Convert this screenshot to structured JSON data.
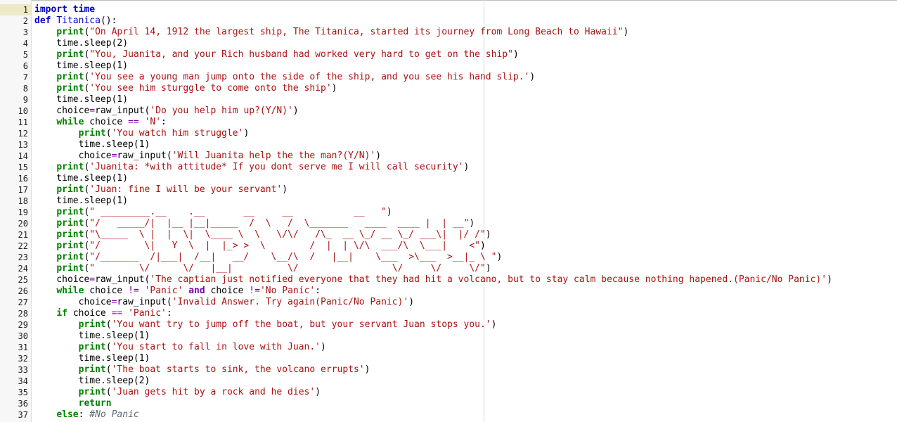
{
  "editor": {
    "colors": {
      "keyword": "#0000cc",
      "builtin": "#008000",
      "string": "#aa1111",
      "comment": "#5a6a7a",
      "operator": "#7700aa",
      "gutter_bg": "#f7f7f7",
      "active_line_number_bg": "#ece9c6"
    },
    "active_line": 1,
    "lines": [
      {
        "n": "1",
        "t": [
          {
            "c": "kw",
            "s": "import"
          },
          {
            "c": "var",
            "s": " "
          },
          {
            "c": "kw",
            "s": "time"
          }
        ]
      },
      {
        "n": "2",
        "t": [
          {
            "c": "kw",
            "s": "def"
          },
          {
            "c": "var",
            "s": " "
          },
          {
            "c": "def",
            "s": "Titanica"
          },
          {
            "c": "var",
            "s": "():"
          }
        ]
      },
      {
        "n": "3",
        "t": [
          {
            "c": "var",
            "s": "    "
          },
          {
            "c": "kw2",
            "s": "print"
          },
          {
            "c": "var",
            "s": "("
          },
          {
            "c": "str",
            "s": "\"On April 14, 1912 the largest ship, The Titanica, started its journey from Long Beach to Hawaii\""
          },
          {
            "c": "var",
            "s": ")"
          }
        ]
      },
      {
        "n": "4",
        "t": [
          {
            "c": "var",
            "s": "    time.sleep("
          },
          {
            "c": "var",
            "s": "2"
          },
          {
            "c": "var",
            "s": ")"
          }
        ]
      },
      {
        "n": "5",
        "t": [
          {
            "c": "var",
            "s": "    "
          },
          {
            "c": "kw2",
            "s": "print"
          },
          {
            "c": "var",
            "s": "("
          },
          {
            "c": "str",
            "s": "\"You, Juanita, and your Rich husband had worked very hard to get on the ship\""
          },
          {
            "c": "var",
            "s": ")"
          }
        ]
      },
      {
        "n": "6",
        "t": [
          {
            "c": "var",
            "s": "    time.sleep("
          },
          {
            "c": "var",
            "s": "1"
          },
          {
            "c": "var",
            "s": ")"
          }
        ]
      },
      {
        "n": "7",
        "t": [
          {
            "c": "var",
            "s": "    "
          },
          {
            "c": "kw2",
            "s": "print"
          },
          {
            "c": "var",
            "s": "("
          },
          {
            "c": "str",
            "s": "'You see a young man jump onto the side of the ship, and you see his hand slip.'"
          },
          {
            "c": "var",
            "s": ")"
          }
        ]
      },
      {
        "n": "8",
        "t": [
          {
            "c": "var",
            "s": "    "
          },
          {
            "c": "kw2",
            "s": "print"
          },
          {
            "c": "var",
            "s": "("
          },
          {
            "c": "str",
            "s": "'You see him sturggle to come onto the ship'"
          },
          {
            "c": "var",
            "s": ")"
          }
        ]
      },
      {
        "n": "9",
        "t": [
          {
            "c": "var",
            "s": "    time.sleep("
          },
          {
            "c": "var",
            "s": "1"
          },
          {
            "c": "var",
            "s": ")"
          }
        ]
      },
      {
        "n": "10",
        "t": [
          {
            "c": "var",
            "s": "    choice"
          },
          {
            "c": "op",
            "s": "="
          },
          {
            "c": "var",
            "s": "raw_input("
          },
          {
            "c": "str",
            "s": "'Do you help him up?(Y/N)'"
          },
          {
            "c": "var",
            "s": ")"
          }
        ]
      },
      {
        "n": "11",
        "t": [
          {
            "c": "var",
            "s": "    "
          },
          {
            "c": "kw2",
            "s": "while"
          },
          {
            "c": "var",
            "s": " choice "
          },
          {
            "c": "op",
            "s": "=="
          },
          {
            "c": "var",
            "s": " "
          },
          {
            "c": "str",
            "s": "'N'"
          },
          {
            "c": "var",
            "s": ":"
          }
        ]
      },
      {
        "n": "12",
        "t": [
          {
            "c": "var",
            "s": "        "
          },
          {
            "c": "kw2",
            "s": "print"
          },
          {
            "c": "var",
            "s": "("
          },
          {
            "c": "str",
            "s": "'You watch him struggle'"
          },
          {
            "c": "var",
            "s": ")"
          }
        ]
      },
      {
        "n": "13",
        "t": [
          {
            "c": "var",
            "s": "        time.sleep("
          },
          {
            "c": "var",
            "s": "1"
          },
          {
            "c": "var",
            "s": ")"
          }
        ]
      },
      {
        "n": "14",
        "t": [
          {
            "c": "var",
            "s": "        choice"
          },
          {
            "c": "op",
            "s": "="
          },
          {
            "c": "var",
            "s": "raw_input("
          },
          {
            "c": "str",
            "s": "'Will Juanita help the the man?(Y/N)'"
          },
          {
            "c": "var",
            "s": ")"
          }
        ]
      },
      {
        "n": "15",
        "t": [
          {
            "c": "var",
            "s": "    "
          },
          {
            "c": "kw2",
            "s": "print"
          },
          {
            "c": "var",
            "s": "("
          },
          {
            "c": "str",
            "s": "'Juanita: *with attitude* If you dont serve me I will call security'"
          },
          {
            "c": "var",
            "s": ")"
          }
        ]
      },
      {
        "n": "16",
        "t": [
          {
            "c": "var",
            "s": "    time.sleep("
          },
          {
            "c": "var",
            "s": "1"
          },
          {
            "c": "var",
            "s": ")"
          }
        ]
      },
      {
        "n": "17",
        "t": [
          {
            "c": "var",
            "s": "    "
          },
          {
            "c": "kw2",
            "s": "print"
          },
          {
            "c": "var",
            "s": "("
          },
          {
            "c": "str",
            "s": "'Juan: fine I will be your servant'"
          },
          {
            "c": "var",
            "s": ")"
          }
        ]
      },
      {
        "n": "18",
        "t": [
          {
            "c": "var",
            "s": "    time.sleep("
          },
          {
            "c": "var",
            "s": "1"
          },
          {
            "c": "var",
            "s": ")"
          }
        ]
      },
      {
        "n": "19",
        "t": [
          {
            "c": "var",
            "s": "    "
          },
          {
            "c": "kw2",
            "s": "print"
          },
          {
            "c": "var",
            "s": "("
          },
          {
            "c": "str",
            "s": "\" _________.__    .__       __     __           __   \""
          },
          {
            "c": "var",
            "s": ")"
          }
        ]
      },
      {
        "n": "20",
        "t": [
          {
            "c": "var",
            "s": "    "
          },
          {
            "c": "kw2",
            "s": "print"
          },
          {
            "c": "var",
            "s": "("
          },
          {
            "c": "str",
            "s": "\"/   _____/|  |__ |__|_____  /  \\   /  \\_______   ____  ____ |  | __\""
          },
          {
            "c": "var",
            "s": ")"
          }
        ]
      },
      {
        "n": "21",
        "t": [
          {
            "c": "var",
            "s": "    "
          },
          {
            "c": "kw2",
            "s": "print"
          },
          {
            "c": "var",
            "s": "("
          },
          {
            "c": "str",
            "s": "\"\\_____  \\ |  |  \\|  \\____ \\  \\   \\/\\/   /\\_  __ \\_/ __ \\_/ ___\\|  |/ /\""
          },
          {
            "c": "var",
            "s": ")"
          }
        ]
      },
      {
        "n": "22",
        "t": [
          {
            "c": "var",
            "s": "    "
          },
          {
            "c": "kw2",
            "s": "print"
          },
          {
            "c": "var",
            "s": "("
          },
          {
            "c": "str",
            "s": "\"/        \\|   Y  \\  |  |_> >  \\        /  |  | \\/\\  ___/\\  \\___|    <\""
          },
          {
            "c": "var",
            "s": ")"
          }
        ]
      },
      {
        "n": "23",
        "t": [
          {
            "c": "var",
            "s": "    "
          },
          {
            "c": "kw2",
            "s": "print"
          },
          {
            "c": "var",
            "s": "("
          },
          {
            "c": "str",
            "s": "\"/_______  /|___|  /__|   __/    \\__/\\  /   |__|    \\___  >\\___  >__|_ \\ \""
          },
          {
            "c": "var",
            "s": ")"
          }
        ]
      },
      {
        "n": "24",
        "t": [
          {
            "c": "var",
            "s": "    "
          },
          {
            "c": "kw2",
            "s": "print"
          },
          {
            "c": "var",
            "s": "("
          },
          {
            "c": "str",
            "s": "\"        \\/      \\/   |__|          \\/                 \\/     \\/     \\/\""
          },
          {
            "c": "var",
            "s": ")"
          }
        ]
      },
      {
        "n": "25",
        "t": [
          {
            "c": "var",
            "s": "    choice"
          },
          {
            "c": "op",
            "s": "="
          },
          {
            "c": "var",
            "s": "raw_input("
          },
          {
            "c": "str",
            "s": "'The captian just notified everyone that they had hit a volcano, but to stay calm because nothing hapened.(Panic/No Panic)'"
          },
          {
            "c": "var",
            "s": ")"
          }
        ]
      },
      {
        "n": "26",
        "t": [
          {
            "c": "var",
            "s": "    "
          },
          {
            "c": "kw2",
            "s": "while"
          },
          {
            "c": "var",
            "s": " choice "
          },
          {
            "c": "op",
            "s": "!="
          },
          {
            "c": "var",
            "s": " "
          },
          {
            "c": "str",
            "s": "'Panic'"
          },
          {
            "c": "var",
            "s": " "
          },
          {
            "c": "kwp",
            "s": "and"
          },
          {
            "c": "var",
            "s": " choice "
          },
          {
            "c": "op",
            "s": "!="
          },
          {
            "c": "str",
            "s": "'No Panic'"
          },
          {
            "c": "var",
            "s": ":"
          }
        ]
      },
      {
        "n": "27",
        "t": [
          {
            "c": "var",
            "s": "        choice"
          },
          {
            "c": "op",
            "s": "="
          },
          {
            "c": "var",
            "s": "raw_input("
          },
          {
            "c": "str",
            "s": "'Invalid Answer. Try again(Panic/No Panic)'"
          },
          {
            "c": "var",
            "s": ")"
          }
        ]
      },
      {
        "n": "28",
        "t": [
          {
            "c": "var",
            "s": "    "
          },
          {
            "c": "kw2",
            "s": "if"
          },
          {
            "c": "var",
            "s": " choice "
          },
          {
            "c": "op",
            "s": "=="
          },
          {
            "c": "var",
            "s": " "
          },
          {
            "c": "str",
            "s": "'Panic'"
          },
          {
            "c": "var",
            "s": ":"
          }
        ]
      },
      {
        "n": "29",
        "t": [
          {
            "c": "var",
            "s": "        "
          },
          {
            "c": "kw2",
            "s": "print"
          },
          {
            "c": "var",
            "s": "("
          },
          {
            "c": "str",
            "s": "'You want try to jump off the boat, but your servant Juan stops you.'"
          },
          {
            "c": "var",
            "s": ")"
          }
        ]
      },
      {
        "n": "30",
        "t": [
          {
            "c": "var",
            "s": "        time.sleep("
          },
          {
            "c": "var",
            "s": "1"
          },
          {
            "c": "var",
            "s": ")"
          }
        ]
      },
      {
        "n": "31",
        "t": [
          {
            "c": "var",
            "s": "        "
          },
          {
            "c": "kw2",
            "s": "print"
          },
          {
            "c": "var",
            "s": "("
          },
          {
            "c": "str",
            "s": "'You start to fall in love with Juan.'"
          },
          {
            "c": "var",
            "s": ")"
          }
        ]
      },
      {
        "n": "32",
        "t": [
          {
            "c": "var",
            "s": "        time.sleep("
          },
          {
            "c": "var",
            "s": "1"
          },
          {
            "c": "var",
            "s": ")"
          }
        ]
      },
      {
        "n": "33",
        "t": [
          {
            "c": "var",
            "s": "        "
          },
          {
            "c": "kw2",
            "s": "print"
          },
          {
            "c": "var",
            "s": "("
          },
          {
            "c": "str",
            "s": "'The boat starts to sink, the volcano errupts'"
          },
          {
            "c": "var",
            "s": ")"
          }
        ]
      },
      {
        "n": "34",
        "t": [
          {
            "c": "var",
            "s": "        time.sleep("
          },
          {
            "c": "var",
            "s": "2"
          },
          {
            "c": "var",
            "s": ")"
          }
        ]
      },
      {
        "n": "35",
        "t": [
          {
            "c": "var",
            "s": "        "
          },
          {
            "c": "kw2",
            "s": "print"
          },
          {
            "c": "var",
            "s": "("
          },
          {
            "c": "str",
            "s": "'Juan gets hit by a rock and he dies'"
          },
          {
            "c": "var",
            "s": ")"
          }
        ]
      },
      {
        "n": "36",
        "t": [
          {
            "c": "var",
            "s": "        "
          },
          {
            "c": "kw2",
            "s": "return"
          }
        ]
      },
      {
        "n": "37",
        "t": [
          {
            "c": "var",
            "s": "    "
          },
          {
            "c": "kw2",
            "s": "else"
          },
          {
            "c": "var",
            "s": ": "
          },
          {
            "c": "cm",
            "s": "#No Panic"
          }
        ]
      }
    ]
  }
}
